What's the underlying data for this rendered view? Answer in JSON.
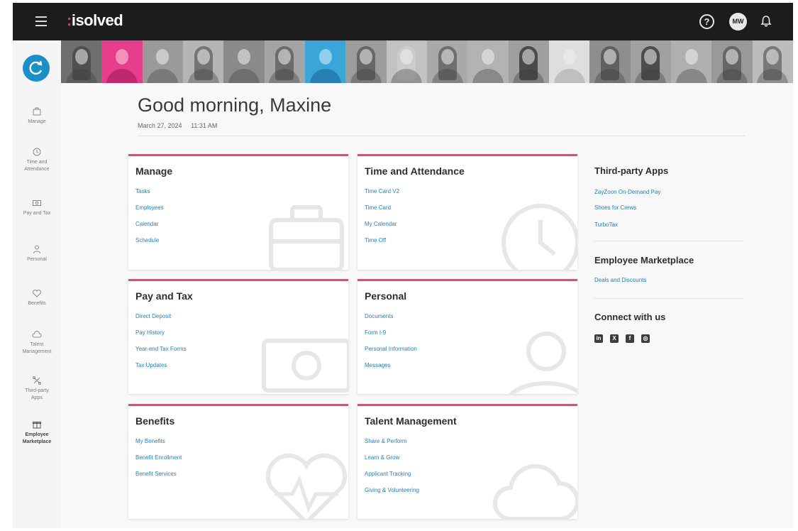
{
  "header": {
    "logo_prefix": ":",
    "logo_text": "isolved",
    "user_initials": "MW",
    "help_glyph": "?"
  },
  "sidebar": {
    "items": [
      {
        "label": "Manage",
        "icon": "briefcase-icon"
      },
      {
        "label": "Time and Attendance",
        "icon": "clock-icon"
      },
      {
        "label": "Pay and Tax",
        "icon": "money-icon"
      },
      {
        "label": "Personal",
        "icon": "person-icon"
      },
      {
        "label": "Benefits",
        "icon": "heart-icon"
      },
      {
        "label": "Talent Management",
        "icon": "cloud-icon"
      },
      {
        "label": "Third-party Apps",
        "icon": "apps-icon"
      },
      {
        "label": "Employee Marketplace",
        "icon": "gift-icon"
      }
    ]
  },
  "greeting": {
    "title": "Good morning, Maxine",
    "date": "March 27, 2024",
    "time": "11:31 AM"
  },
  "cards": {
    "manage": {
      "title": "Manage",
      "links": [
        "Tasks",
        "Employees",
        "Calendar",
        "Schedule"
      ]
    },
    "time": {
      "title": "Time and Attendance",
      "links": [
        "Time Card V2",
        "Time Card",
        "My Calendar",
        "Time Off"
      ]
    },
    "pay": {
      "title": "Pay and Tax",
      "links": [
        "Direct Deposit",
        "Pay History",
        "Year-end Tax Forms",
        "Tax Updates"
      ]
    },
    "personal": {
      "title": "Personal",
      "links": [
        "Documents",
        "Form I-9",
        "Personal Information",
        "Messages"
      ]
    },
    "benefits": {
      "title": "Benefits",
      "links": [
        "My Benefits",
        "Benefit Enrollment",
        "Benefit Services"
      ]
    },
    "talent": {
      "title": "Talent Management",
      "links": [
        "Share & Perform",
        "Learn & Grow",
        "Applicant Tracking",
        "Giving & Volunteering"
      ]
    }
  },
  "third_party": {
    "title": "Third-party Apps",
    "links": [
      "ZayZoon On-Demand Pay",
      "Shoes for Crews",
      "TurboTax"
    ]
  },
  "marketplace": {
    "title": "Employee Marketplace",
    "links": [
      "Deals and Discounts"
    ]
  },
  "connect": {
    "title": "Connect with us",
    "icons": [
      "linkedin-icon",
      "x-icon",
      "facebook-icon",
      "instagram-icon"
    ],
    "glyphs": [
      "in",
      "X",
      "f",
      "◎"
    ]
  },
  "colors": {
    "accent_pink": "#e04a7c",
    "link_blue": "#2b7fb8",
    "topbar": "#1c1c1c",
    "brand_blue": "#1b8fc7"
  }
}
